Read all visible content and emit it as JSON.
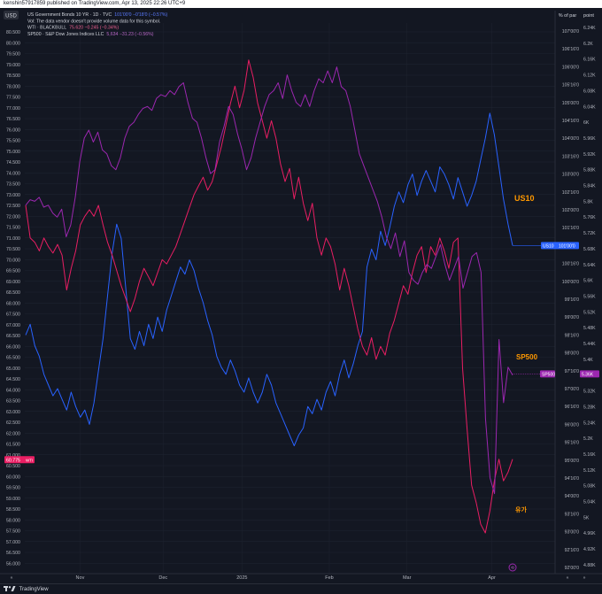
{
  "header": {
    "published": "kenshin57917859 published on TradingView.com, Apr 13, 2025 22:26 UTC+9"
  },
  "toolbar": {
    "currency_button": "USD",
    "left_axis_label": "",
    "right_axis_labels": [
      "% of par",
      "point"
    ]
  },
  "legend": [
    {
      "name": "US Government Bonds 10 YR · 1D · TVC",
      "values": "101'00'0  −0'18'0 (−0.57%)",
      "color": "#2962ff",
      "value_color": "#5b7bff"
    },
    {
      "name": "Vol: The data vendor doesn't provide volume data for this symbol.",
      "values": "",
      "color": "#d1d4dc",
      "value_color": "#d1d4dc"
    },
    {
      "name": "WTI · BLACKBULL",
      "values": "75.620  −0.245 (−0.34%)",
      "color": "#e91e63",
      "value_color": "#f06292"
    },
    {
      "name": "SP500 · S&P Dow Jones Indices LLC",
      "values": "5,634  −31.23 (−0.56%)",
      "color": "#9c27b0",
      "value_color": "#ba68c8"
    }
  ],
  "annotations": {
    "us10": "US10",
    "sp500": "SP500",
    "oil": "유가",
    "annotation_color": "#ff9800"
  },
  "bottom": {
    "brand": "TradingView"
  },
  "chart_data": {
    "type": "line",
    "x_ticks": [
      "Nov",
      "Dec",
      "2025",
      "Feb",
      "Mar",
      "Apr"
    ],
    "x_tick_positions": [
      0.133,
      0.271,
      0.402,
      0.547,
      0.676,
      0.817
    ],
    "left_axis": {
      "min": 55.5,
      "max": 81.0,
      "ticks": [
        "56.000",
        "56.500",
        "57.000",
        "57.500",
        "58.000",
        "58.500",
        "59.000",
        "59.500",
        "60.000",
        "60.500",
        "61.000",
        "61.500",
        "62.000",
        "62.500",
        "63.000",
        "63.500",
        "64.000",
        "64.500",
        "65.000",
        "65.500",
        "66.000",
        "66.500",
        "67.000",
        "67.500",
        "68.000",
        "68.500",
        "69.000",
        "69.500",
        "70.000",
        "70.500",
        "71.000",
        "71.500",
        "72.000",
        "72.500",
        "73.000",
        "73.500",
        "74.000",
        "74.500",
        "75.000",
        "75.500",
        "76.000",
        "76.500",
        "77.000",
        "77.500",
        "78.000",
        "78.500",
        "79.000",
        "79.500",
        "80.000",
        "80.500"
      ]
    },
    "right_axis_bonds": {
      "ticks": [
        "92'00'0",
        "92'16'0",
        "93'00'0",
        "93'16'0",
        "94'00'0",
        "94'16'0",
        "95'00'0",
        "95'16'0",
        "96'00'0",
        "96'16'0",
        "97'00'0",
        "97'16'0",
        "98'00'0",
        "98'16'0",
        "99'00'0",
        "99'16'0",
        "100'00'0",
        "100'16'0",
        "101'00'0",
        "101'16'0",
        "102'00'0",
        "102'16'0",
        "103'00'0",
        "103'16'0",
        "104'00'0",
        "104'16'0",
        "105'00'0",
        "105'16'0",
        "106'00'0",
        "106'16'0",
        "107'00'0"
      ]
    },
    "right_axis_points": {
      "ticks": [
        "4.88K",
        "4.92K",
        "4.96K",
        "5K",
        "5.04K",
        "5.08K",
        "5.12K",
        "5.16K",
        "5.2K",
        "5.24K",
        "5.28K",
        "5.32K",
        "5.36K",
        "5.4K",
        "5.44K",
        "5.48K",
        "5.52K",
        "5.56K",
        "5.6K",
        "5.64K",
        "5.68K",
        "5.72K",
        "5.76K",
        "5.8K",
        "5.84K",
        "5.88K",
        "5.92K",
        "5.96K",
        "6K",
        "6.04K",
        "6.08K",
        "6.12K",
        "6.16K",
        "6.2K",
        "6.24K"
      ]
    },
    "price_labels": [
      {
        "text": "60.775",
        "sub": "WTI",
        "value": 60.775,
        "axis": "left",
        "color": "#e91e63"
      },
      {
        "text": "US10",
        "sub": "101'00'0",
        "value": 101.0,
        "axis": "bonds",
        "color": "#2962ff"
      },
      {
        "text": "SP500",
        "sub": "5.36K",
        "value": 5363,
        "axis": "points",
        "color": "#9c27b0"
      }
    ],
    "series": [
      {
        "name": "US10",
        "color": "#2962ff",
        "axis": "bonds",
        "values": [
          98.5,
          98.8,
          98.2,
          97.9,
          97.4,
          97.1,
          96.8,
          97.0,
          96.7,
          96.4,
          96.9,
          96.5,
          96.2,
          96.4,
          96.0,
          96.6,
          97.5,
          98.4,
          99.6,
          100.8,
          101.6,
          101.2,
          99.8,
          98.4,
          98.1,
          98.6,
          98.2,
          98.8,
          98.4,
          99.0,
          98.6,
          99.2,
          99.6,
          100.0,
          100.4,
          100.2,
          100.6,
          100.3,
          99.8,
          99.4,
          98.9,
          98.5,
          97.9,
          97.6,
          97.4,
          97.8,
          97.5,
          97.1,
          96.9,
          97.3,
          96.9,
          96.6,
          96.9,
          97.4,
          97.1,
          96.6,
          96.3,
          96.0,
          95.7,
          95.4,
          95.7,
          95.9,
          96.5,
          96.3,
          96.7,
          96.4,
          96.9,
          97.2,
          96.8,
          97.4,
          97.8,
          97.3,
          97.7,
          98.2,
          98.6,
          100.4,
          100.9,
          100.6,
          101.4,
          101.0,
          101.5,
          102.1,
          102.5,
          102.2,
          102.7,
          103.0,
          102.4,
          102.8,
          103.1,
          102.8,
          102.5,
          103.2,
          103.0,
          102.7,
          102.3,
          102.9,
          102.5,
          102.1,
          102.4,
          102.8,
          103.4,
          104.0,
          104.7,
          104.1,
          103.2,
          102.3,
          101.6,
          101.0
        ]
      },
      {
        "name": "WTI",
        "color": "#e91e63",
        "axis": "left",
        "values": [
          72.5,
          71.0,
          70.8,
          70.4,
          71.0,
          70.6,
          70.3,
          70.7,
          70.2,
          68.6,
          69.6,
          70.4,
          71.6,
          72.0,
          72.3,
          72.0,
          72.5,
          71.6,
          70.8,
          70.2,
          69.5,
          68.8,
          68.2,
          67.6,
          68.2,
          69.0,
          69.6,
          69.2,
          68.8,
          69.4,
          70.0,
          69.8,
          70.2,
          70.6,
          71.2,
          71.8,
          72.4,
          73.0,
          73.4,
          73.8,
          73.2,
          73.6,
          74.4,
          75.2,
          76.2,
          77.2,
          78.0,
          77.0,
          77.8,
          79.2,
          78.4,
          77.2,
          76.4,
          75.6,
          76.4,
          75.6,
          74.4,
          73.6,
          74.2,
          72.8,
          73.8,
          72.6,
          71.8,
          72.6,
          71.0,
          70.2,
          71.0,
          70.6,
          69.8,
          68.6,
          69.6,
          68.8,
          67.8,
          66.8,
          66.0,
          65.6,
          66.4,
          65.4,
          66.0,
          65.6,
          66.6,
          67.2,
          68.0,
          68.8,
          68.4,
          69.4,
          70.2,
          70.6,
          69.4,
          70.6,
          70.2,
          71.0,
          70.4,
          69.6,
          70.8,
          71.0,
          65.0,
          62.2,
          59.6,
          58.8,
          57.8,
          57.4,
          58.4,
          59.8,
          60.8,
          59.8,
          60.2,
          60.8
        ]
      },
      {
        "name": "SP500",
        "color": "#9c27b0",
        "axis": "points",
        "values": [
          5790,
          5804,
          5800,
          5810,
          5785,
          5790,
          5770,
          5760,
          5780,
          5710,
          5740,
          5810,
          5900,
          5960,
          5980,
          5950,
          5975,
          5930,
          5920,
          5890,
          5880,
          5910,
          5960,
          5990,
          6000,
          6020,
          6035,
          6040,
          6030,
          6060,
          6070,
          6065,
          6080,
          6070,
          6090,
          6100,
          6050,
          6010,
          6000,
          5960,
          5910,
          5870,
          5880,
          5950,
          5990,
          6040,
          6020,
          5970,
          5930,
          5880,
          5910,
          5960,
          6000,
          6040,
          6070,
          6080,
          6100,
          6060,
          6120,
          6080,
          6050,
          6040,
          6070,
          6040,
          6080,
          6110,
          6100,
          6130,
          6100,
          6140,
          6090,
          6080,
          6040,
          5980,
          5920,
          5890,
          5860,
          5830,
          5800,
          5760,
          5710,
          5680,
          5720,
          5660,
          5700,
          5620,
          5600,
          5590,
          5620,
          5640,
          5630,
          5660,
          5690,
          5640,
          5600,
          5630,
          5660,
          5580,
          5620,
          5660,
          5670,
          5620,
          5250,
          5100,
          5060,
          5450,
          5290,
          5380,
          5360
        ]
      }
    ]
  }
}
